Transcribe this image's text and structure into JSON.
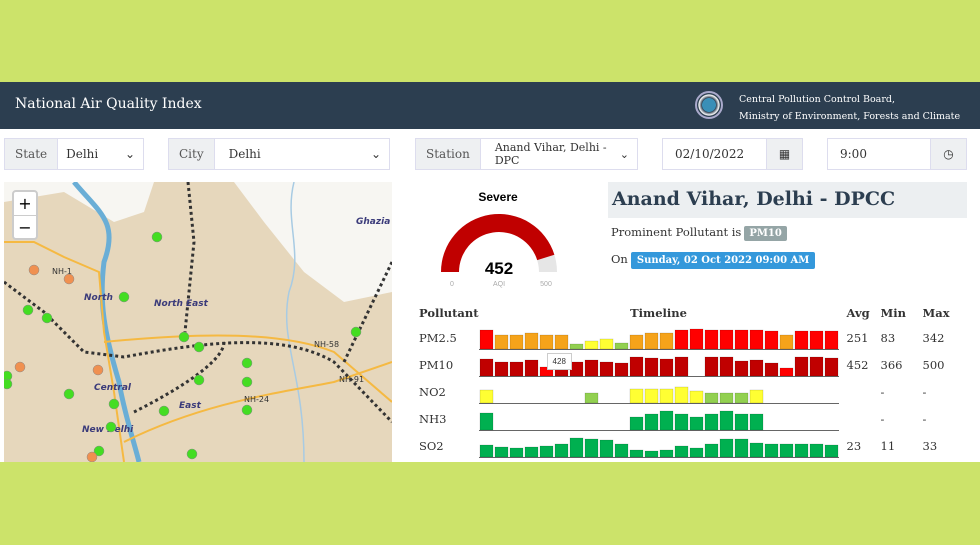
{
  "header": {
    "title": "National Air Quality Index",
    "org_line1": "Central Pollution Control Board,",
    "org_line2": "Ministry of Environment, Forests and Climate Change"
  },
  "filters": {
    "state_label": "State",
    "state_value": "Delhi",
    "city_label": "City",
    "city_value": "Delhi",
    "station_label": "Station",
    "station_value": "Anand Vihar, Delhi - DPC",
    "date_value": "02/10/2022",
    "time_value": "9:00"
  },
  "map": {
    "zoom_in": "+",
    "zoom_out": "−",
    "labels": [
      "Ghazia",
      "North",
      "North East",
      "Central",
      "East",
      "New Delhi",
      "NH-1",
      "NH-24",
      "NH-58",
      "NH-91"
    ]
  },
  "gauge": {
    "category": "Severe",
    "value": "452",
    "unit": "AQI",
    "min": "0",
    "max": "500",
    "fraction": 0.904,
    "color": "#c00000"
  },
  "station": {
    "name": "Anand Vihar, Delhi - DPCC",
    "prominent_prefix": "Prominent Pollutant is",
    "prominent": "PM10",
    "on_prefix": "On",
    "datetime": "Sunday, 02 Oct 2022 09:00 AM"
  },
  "table": {
    "headers": [
      "Pollutant",
      "Timeline",
      "Avg",
      "Min",
      "Max"
    ],
    "tooltip": "428",
    "colors": {
      "R": "#ff0000",
      "O": "#f5a31a",
      "G": "#92d050",
      "Y": "#ffff33",
      "D": "#c00000",
      "N": "#00b050"
    },
    "rows": [
      {
        "name": "PM2.5",
        "avg": "251",
        "min": "83",
        "max": "342",
        "bars": "R95 O70 O70 O80 O70 O70 G25 Y40 Y50 G30 O70 O80 O80 R95 R100 R95 R95 R95 R95 R90 O70 R90 R90 R90"
      },
      {
        "name": "PM10",
        "avg": "452",
        "min": "366",
        "max": "500",
        "bars": "D85 D70 D70 D80 R45 D70 D70 D80 D70 D65 D95 D90 D85 D95 - D95 D95 D75 D80 D65 R40 D95 D95 D90"
      },
      {
        "name": "NO2",
        "avg": "",
        "min": "-",
        "max": "-",
        "bars": "Y65 - - - - - - G50 - - Y70 Y70 Y70 Y80 Y60 G50 G50 G50 Y65 - - - - -"
      },
      {
        "name": "NH3",
        "avg": "",
        "min": "-",
        "max": "-",
        "bars": "N85 - - - - - - - - - N65 N80 N95 N80 N65 N80 N95 N80 N80 - - - - -"
      },
      {
        "name": "SO2",
        "avg": "23",
        "min": "11",
        "max": "33",
        "bars": "N60 N50 N45 N50 N55 N65 N95 N90 N85 N65 N35 N30 N35 N55 N45 N65 N90 N90 N70 N65 N65 N65 N65 N60"
      }
    ]
  }
}
